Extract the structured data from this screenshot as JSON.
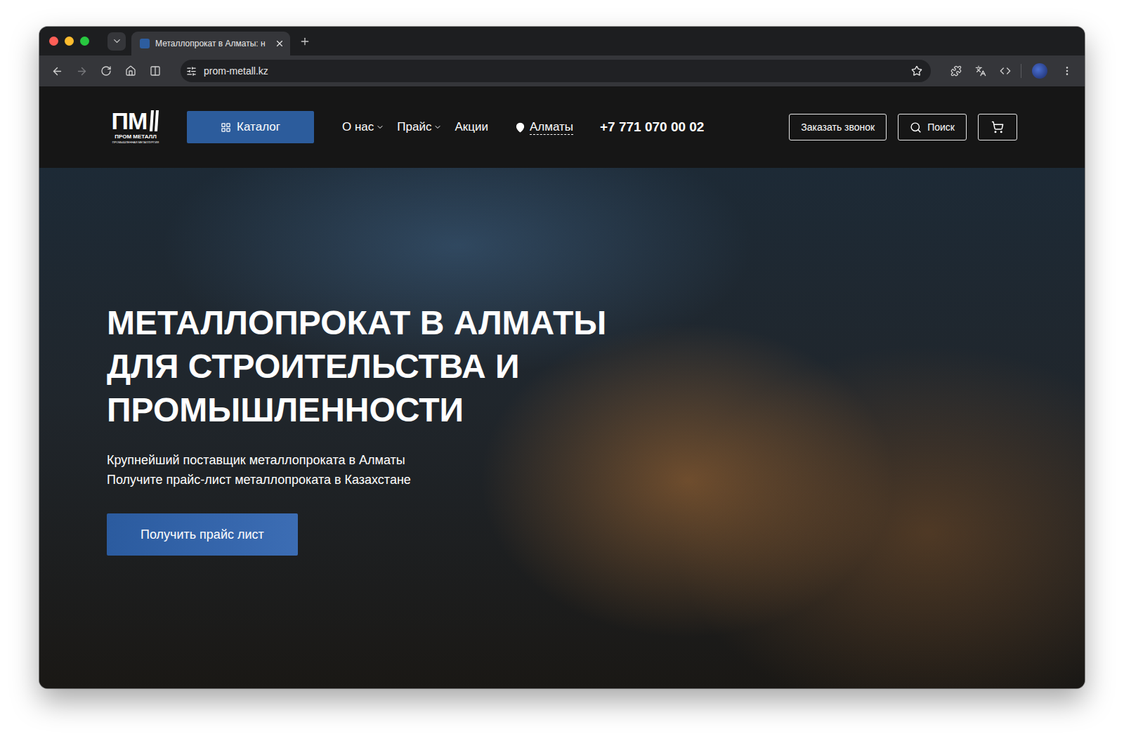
{
  "browser": {
    "traffic_lights": [
      {
        "name": "close",
        "color": "#ff5f57"
      },
      {
        "name": "minimize",
        "color": "#febc2e"
      },
      {
        "name": "zoom",
        "color": "#28c840"
      }
    ],
    "tab": {
      "title": "Металлопрокат в Алматы: н",
      "selected": true
    },
    "url": "prom-metall.kz",
    "forward_disabled": true
  },
  "header": {
    "logo": {
      "mark": "ПМ",
      "name": "ПРОМ МЕТАЛЛ",
      "tagline": "ПРОМЫШЛЕННАЯ МЕТАЛЛУРГИЯ"
    },
    "catalog": "Каталог",
    "nav": [
      {
        "label": "О нас",
        "dropdown": true
      },
      {
        "label": "Прайс",
        "dropdown": true
      },
      {
        "label": "Акции",
        "dropdown": false
      }
    ],
    "city": "Алматы",
    "phone": "+7 771 070 00 02",
    "callback": "Заказать звонок",
    "search": "Поиск"
  },
  "hero": {
    "title": [
      "МЕТАЛЛОПРОКАТ В АЛМАТЫ",
      "ДЛЯ СТРОИТЕЛЬСТВА И",
      "ПРОМЫШЛЕННОСТИ"
    ],
    "subtitle": [
      "Крупнейший поставщик металлопроката в Алматы",
      "Получите прайс-лист металлопроката в Казахстане"
    ],
    "button": "Получить прайс лист"
  }
}
